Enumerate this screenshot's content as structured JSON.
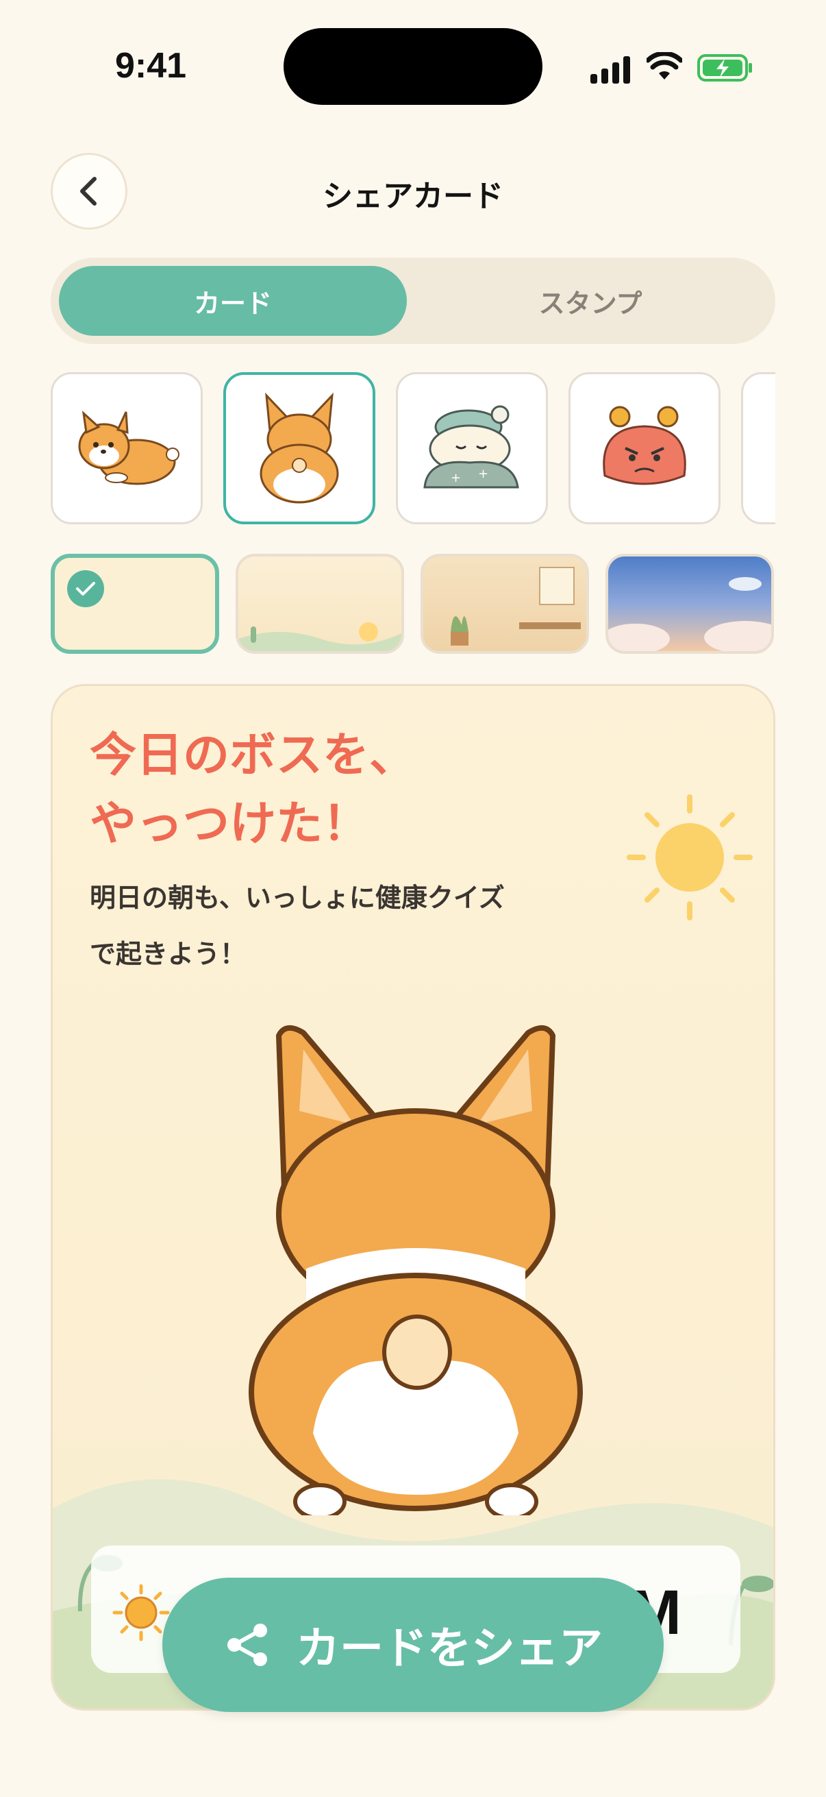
{
  "status_bar": {
    "time": "9:41"
  },
  "header": {
    "title": "シェアカード",
    "back_icon": "chevron-left-icon"
  },
  "tabs": [
    {
      "label": "カード",
      "active": true
    },
    {
      "label": "スタンプ",
      "active": false
    }
  ],
  "stickers": {
    "selected_index": 1,
    "items": [
      "corgi-lying-sticker",
      "corgi-back-sticker",
      "sleepy-blanket-sticker",
      "angry-alarm-clock-sticker",
      "partial-sticker"
    ]
  },
  "backgrounds": {
    "selected_index": 0,
    "items": [
      "plain-cream-background",
      "sunrise-hills-background",
      "sunny-room-background",
      "sky-clouds-background"
    ]
  },
  "card": {
    "headline_line1": "今日のボスを、",
    "headline_line2": "やっつけた！",
    "subtext_line1": "明日の朝も、いっしょに健康クイズ",
    "subtext_line2": "で起きよう！",
    "strip_text_partial": "M"
  },
  "share_button": {
    "label": "カードをシェア",
    "icon": "share-icon"
  },
  "colors": {
    "accent": "#66BEA6",
    "headline": "#EF6A52",
    "background": "#FDF8EE"
  }
}
